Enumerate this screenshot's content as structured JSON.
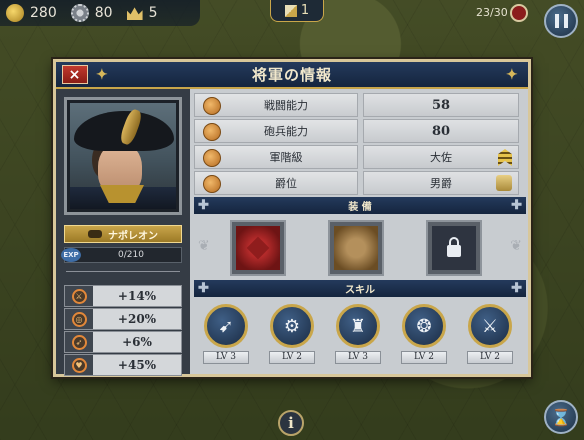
{
  "hud": {
    "gold": "280",
    "industry": "80",
    "command": "5",
    "turn": "1",
    "army_count": "23/30"
  },
  "dialog": {
    "title": "将軍の情報",
    "close_label": "×",
    "general_name": "ナポレオン",
    "exp_label": "EXP",
    "exp_value": "0/210",
    "bonuses": [
      {
        "icon": "infantry-attack-icon",
        "value": "+14%"
      },
      {
        "icon": "artillery-attack-icon",
        "value": "+20%"
      },
      {
        "icon": "movement-icon",
        "value": "+6%"
      },
      {
        "icon": "health-icon",
        "value": "+45%"
      }
    ],
    "stats": [
      {
        "label": "戦闘能力",
        "value": "58",
        "icon": "sword-icon"
      },
      {
        "label": "砲兵能力",
        "value": "80",
        "icon": "cannon-icon"
      },
      {
        "label": "軍階級",
        "value": "大佐",
        "icon": "rank-icon"
      },
      {
        "label": "爵位",
        "value": "男爵",
        "icon": "crown-icon"
      }
    ],
    "equip_title": "装 備",
    "equipment": [
      {
        "icon": "red-seal-icon",
        "locked": false
      },
      {
        "icon": "supply-icon",
        "locked": false
      },
      {
        "icon": "lock-icon",
        "locked": true
      }
    ],
    "skills_title": "スキル",
    "skills": [
      {
        "icon": "artillery-skill-icon",
        "level": "LV 3"
      },
      {
        "icon": "wheel-skill-icon",
        "level": "LV 2"
      },
      {
        "icon": "fortress-skill-icon",
        "level": "LV 3"
      },
      {
        "icon": "laurel-skill-icon",
        "level": "LV 2"
      },
      {
        "icon": "crossed-swords-skill-icon",
        "level": "LV 2"
      }
    ]
  },
  "colors": {
    "title_bar": "#15253e",
    "gold_accent": "#c9a64a",
    "panel_bg": "#c8ccd0",
    "close_red": "#c23a2e"
  }
}
